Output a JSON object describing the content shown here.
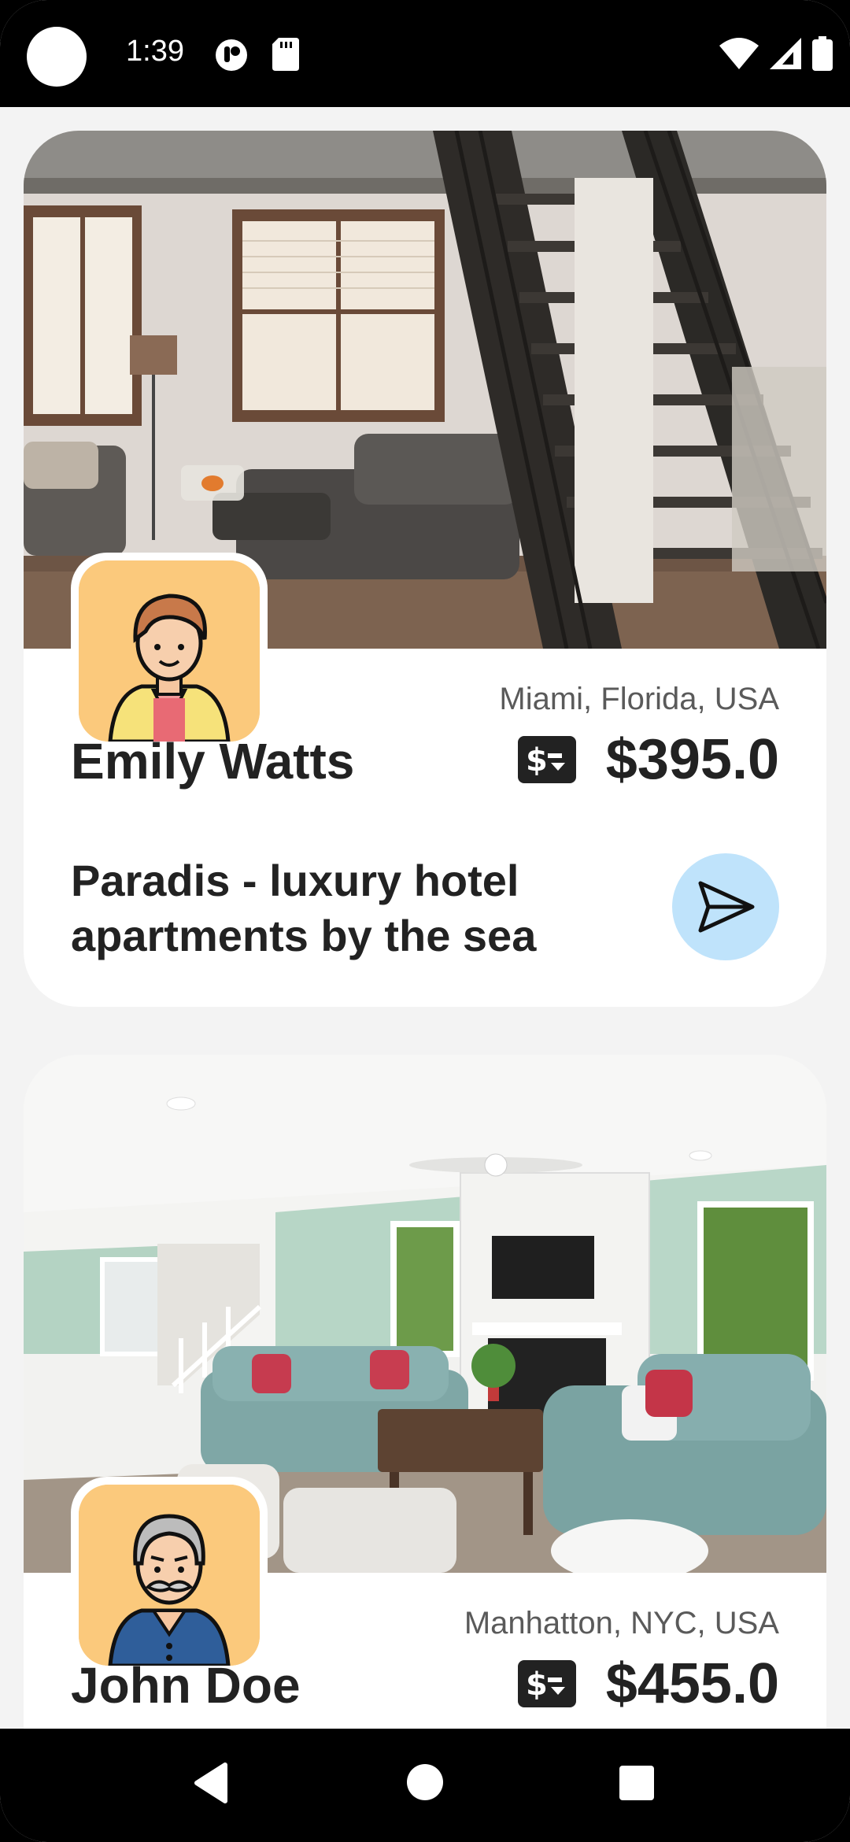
{
  "status_bar": {
    "time": "1:39"
  },
  "listings": [
    {
      "host_name": "Emily Watts",
      "location": "Miami, Florida, USA",
      "price": "$395.0",
      "title": "Paradis - luxury hotel apartments by the sea",
      "avatar_icon": "woman-avatar-icon",
      "photo": "loft-living-room-with-staircase"
    },
    {
      "host_name": "John Doe",
      "location": "Manhatton, NYC, USA",
      "price": "$455.0",
      "avatar_icon": "old-man-avatar-icon",
      "photo": "living-room-with-teal-sofas"
    }
  ],
  "colors": {
    "avatar_bg": "#fbc97c",
    "send_button_bg": "#bfe3fb",
    "text_dark": "#222222",
    "text_muted": "#5a5a5a"
  }
}
